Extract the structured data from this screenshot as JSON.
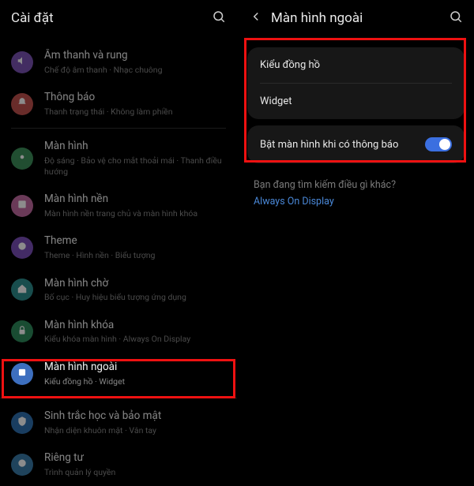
{
  "left": {
    "title": "Cài đặt",
    "items": [
      {
        "label": "Âm thanh và rung",
        "sub": "Chế độ âm thanh  ·  Nhạc chuông",
        "iconBg": "#7a52b3"
      },
      {
        "label": "Thông báo",
        "sub": "Thanh trạng thái  ·  Không làm phiền",
        "iconBg": "#c0504d"
      },
      {
        "label": "Màn hình",
        "sub": "Độ sáng  ·  Bảo vệ cho mắt thoải mái  ·  Thanh điều hướng",
        "iconBg": "#3d8f5a"
      },
      {
        "label": "Màn hình nền",
        "sub": "Màn hình nền trang chủ và màn hình khóa",
        "iconBg": "#c26aa0"
      },
      {
        "label": "Theme",
        "sub": "Theme  ·  Hình nền  ·  Biểu tượng",
        "iconBg": "#7a4fb8"
      },
      {
        "label": "Màn hình chờ",
        "sub": "Bố cục  ·  Huy hiệu biểu tượng ứng dụng",
        "iconBg": "#2d8c8c"
      },
      {
        "label": "Màn hình khóa",
        "sub": "Kiểu khóa màn hình  ·  Always On Display",
        "iconBg": "#2f8a5c"
      },
      {
        "label": "Màn hình ngoài",
        "sub": "Kiểu đồng hồ  ·  Widget",
        "iconBg": "#3d6fbf",
        "active": true
      },
      {
        "label": "Sinh trắc học và bảo mật",
        "sub": "Nhận diện khuôn mặt  ·  Vân tay",
        "iconBg": "#2f6fb0"
      },
      {
        "label": "Riêng tư",
        "sub": "Trình quản lý quyền",
        "iconBg": "#3a7aa8"
      }
    ]
  },
  "right": {
    "title": "Màn hình ngoài",
    "rows": {
      "clock": "Kiểu đồng hồ",
      "widget": "Widget",
      "notify": "Bật màn hình khi có thông báo"
    },
    "hint": "Bạn đang tìm kiếm điều gì khác?",
    "link": "Always On Display"
  }
}
